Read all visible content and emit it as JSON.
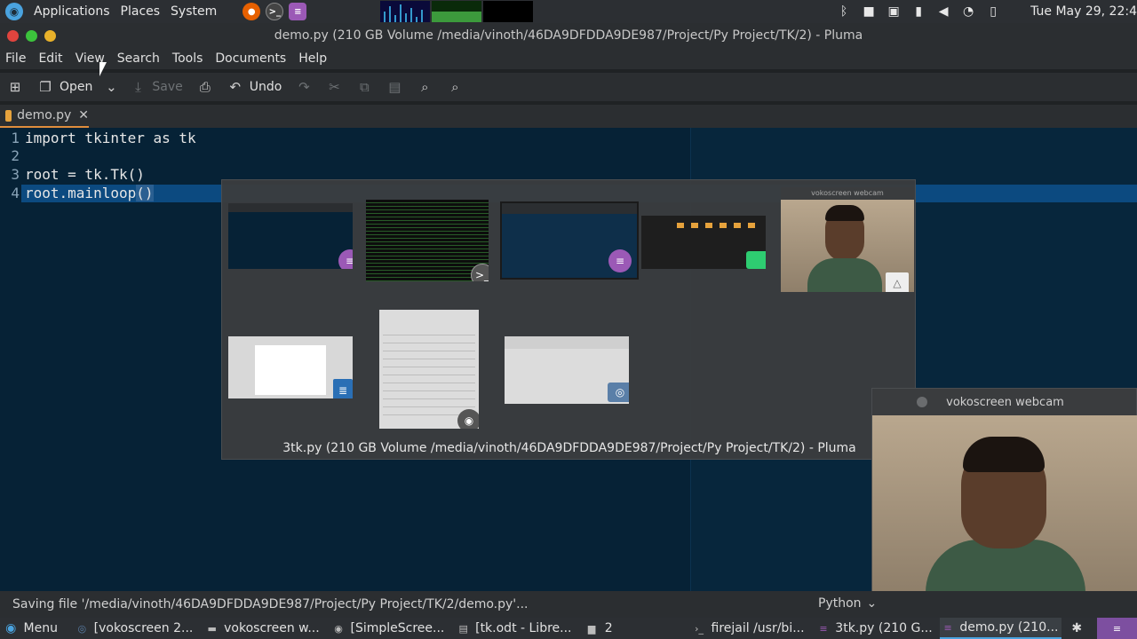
{
  "top_panel": {
    "menus": [
      "Applications",
      "Places",
      "System"
    ],
    "launchers": [
      "firefox-icon",
      "terminal-icon",
      "text-editor-icon"
    ],
    "clock": "Tue May 29, 22:4",
    "tray": [
      "bluetooth-icon",
      "camera-icon",
      "clipboard-icon",
      "microphone-icon",
      "volume-icon",
      "network-icon",
      "battery-icon"
    ]
  },
  "window": {
    "title": "demo.py (210 GB Volume /media/vinoth/46DA9DFDDA9DE987/Project/Py Project/TK/2) - Pluma"
  },
  "menubar": {
    "items": [
      "File",
      "Edit",
      "View",
      "Search",
      "Tools",
      "Documents",
      "Help"
    ]
  },
  "toolbar": {
    "new_icon": "new-document-icon",
    "open_label": "Open",
    "save_label": "Save",
    "undo_label": "Undo"
  },
  "tab": {
    "label": "demo.py"
  },
  "editor": {
    "lines": [
      {
        "num": "1",
        "text": "import tkinter as tk"
      },
      {
        "num": "2",
        "text": ""
      },
      {
        "num": "3",
        "text": "root = tk.Tk()"
      },
      {
        "num": "4",
        "text": "root.mainloop()"
      }
    ]
  },
  "switcher": {
    "caption": "3tk.py (210 GB Volume /media/vinoth/46DA9DFDDA9DE987/Project/Py Project/TK/2) - Pluma",
    "webcam_thumb_title": "vokoscreen webcam"
  },
  "webcam": {
    "title": "vokoscreen webcam"
  },
  "statusbar": {
    "message": "Saving file '/media/vinoth/46DA9DFDDA9DE987/Project/Py Project/TK/2/demo.py'...",
    "language": "Python"
  },
  "bottom_panel": {
    "menu_label": "Menu",
    "tasks": [
      "[vokoscreen 2...",
      "vokoscreen w...",
      "[SimpleScree...",
      "[tk.odt - Libre...",
      "2",
      "firejail /usr/bi...",
      "3tk.py (210 G...",
      "demo.py (210..."
    ]
  },
  "colors": {
    "accent": "#4aa3df",
    "editor_bg": "#062236",
    "selection": "#0c4a80",
    "tab_underline": "#e08d3c"
  }
}
